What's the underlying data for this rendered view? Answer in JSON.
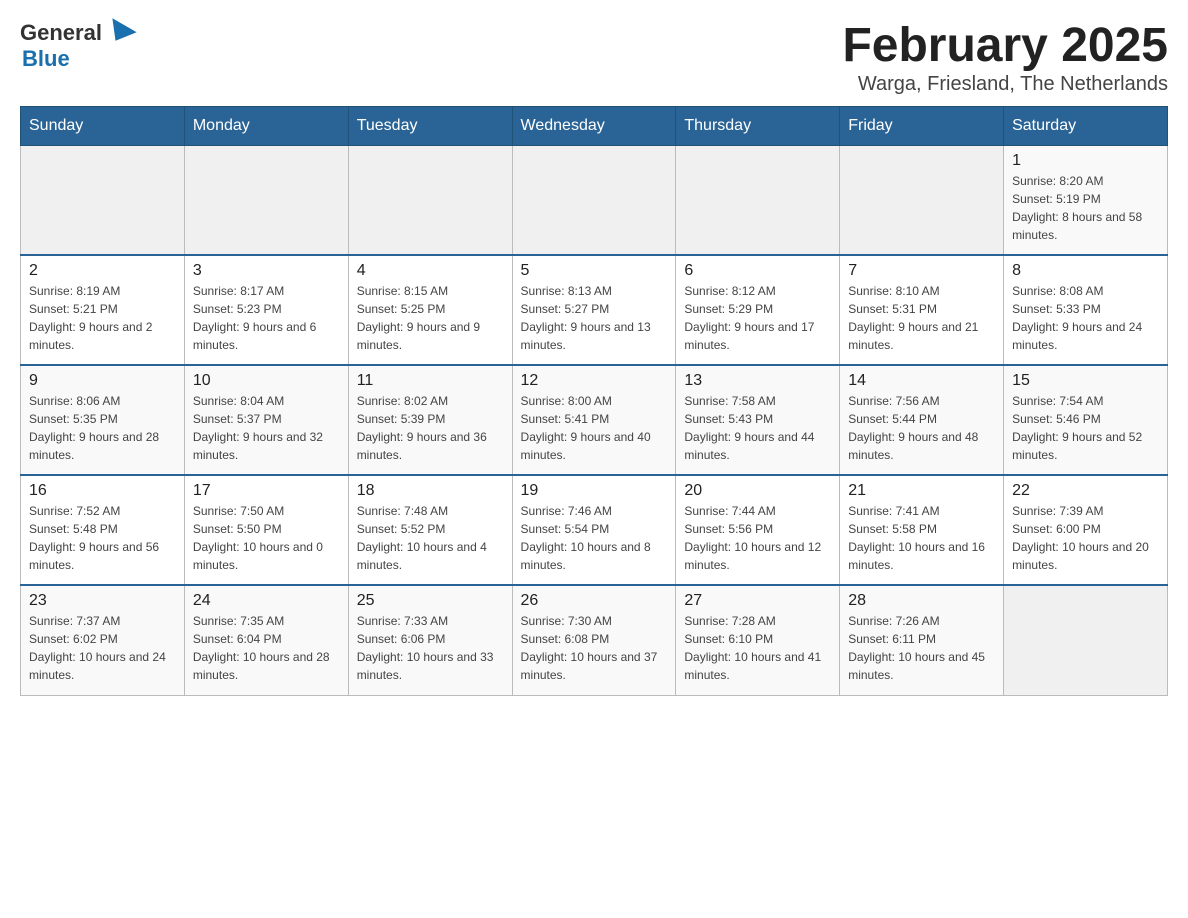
{
  "logo": {
    "general": "General",
    "blue": "Blue"
  },
  "title": "February 2025",
  "subtitle": "Warga, Friesland, The Netherlands",
  "weekdays": [
    "Sunday",
    "Monday",
    "Tuesday",
    "Wednesday",
    "Thursday",
    "Friday",
    "Saturday"
  ],
  "weeks": [
    [
      {
        "day": "",
        "info": ""
      },
      {
        "day": "",
        "info": ""
      },
      {
        "day": "",
        "info": ""
      },
      {
        "day": "",
        "info": ""
      },
      {
        "day": "",
        "info": ""
      },
      {
        "day": "",
        "info": ""
      },
      {
        "day": "1",
        "info": "Sunrise: 8:20 AM\nSunset: 5:19 PM\nDaylight: 8 hours and 58 minutes."
      }
    ],
    [
      {
        "day": "2",
        "info": "Sunrise: 8:19 AM\nSunset: 5:21 PM\nDaylight: 9 hours and 2 minutes."
      },
      {
        "day": "3",
        "info": "Sunrise: 8:17 AM\nSunset: 5:23 PM\nDaylight: 9 hours and 6 minutes."
      },
      {
        "day": "4",
        "info": "Sunrise: 8:15 AM\nSunset: 5:25 PM\nDaylight: 9 hours and 9 minutes."
      },
      {
        "day": "5",
        "info": "Sunrise: 8:13 AM\nSunset: 5:27 PM\nDaylight: 9 hours and 13 minutes."
      },
      {
        "day": "6",
        "info": "Sunrise: 8:12 AM\nSunset: 5:29 PM\nDaylight: 9 hours and 17 minutes."
      },
      {
        "day": "7",
        "info": "Sunrise: 8:10 AM\nSunset: 5:31 PM\nDaylight: 9 hours and 21 minutes."
      },
      {
        "day": "8",
        "info": "Sunrise: 8:08 AM\nSunset: 5:33 PM\nDaylight: 9 hours and 24 minutes."
      }
    ],
    [
      {
        "day": "9",
        "info": "Sunrise: 8:06 AM\nSunset: 5:35 PM\nDaylight: 9 hours and 28 minutes."
      },
      {
        "day": "10",
        "info": "Sunrise: 8:04 AM\nSunset: 5:37 PM\nDaylight: 9 hours and 32 minutes."
      },
      {
        "day": "11",
        "info": "Sunrise: 8:02 AM\nSunset: 5:39 PM\nDaylight: 9 hours and 36 minutes."
      },
      {
        "day": "12",
        "info": "Sunrise: 8:00 AM\nSunset: 5:41 PM\nDaylight: 9 hours and 40 minutes."
      },
      {
        "day": "13",
        "info": "Sunrise: 7:58 AM\nSunset: 5:43 PM\nDaylight: 9 hours and 44 minutes."
      },
      {
        "day": "14",
        "info": "Sunrise: 7:56 AM\nSunset: 5:44 PM\nDaylight: 9 hours and 48 minutes."
      },
      {
        "day": "15",
        "info": "Sunrise: 7:54 AM\nSunset: 5:46 PM\nDaylight: 9 hours and 52 minutes."
      }
    ],
    [
      {
        "day": "16",
        "info": "Sunrise: 7:52 AM\nSunset: 5:48 PM\nDaylight: 9 hours and 56 minutes."
      },
      {
        "day": "17",
        "info": "Sunrise: 7:50 AM\nSunset: 5:50 PM\nDaylight: 10 hours and 0 minutes."
      },
      {
        "day": "18",
        "info": "Sunrise: 7:48 AM\nSunset: 5:52 PM\nDaylight: 10 hours and 4 minutes."
      },
      {
        "day": "19",
        "info": "Sunrise: 7:46 AM\nSunset: 5:54 PM\nDaylight: 10 hours and 8 minutes."
      },
      {
        "day": "20",
        "info": "Sunrise: 7:44 AM\nSunset: 5:56 PM\nDaylight: 10 hours and 12 minutes."
      },
      {
        "day": "21",
        "info": "Sunrise: 7:41 AM\nSunset: 5:58 PM\nDaylight: 10 hours and 16 minutes."
      },
      {
        "day": "22",
        "info": "Sunrise: 7:39 AM\nSunset: 6:00 PM\nDaylight: 10 hours and 20 minutes."
      }
    ],
    [
      {
        "day": "23",
        "info": "Sunrise: 7:37 AM\nSunset: 6:02 PM\nDaylight: 10 hours and 24 minutes."
      },
      {
        "day": "24",
        "info": "Sunrise: 7:35 AM\nSunset: 6:04 PM\nDaylight: 10 hours and 28 minutes."
      },
      {
        "day": "25",
        "info": "Sunrise: 7:33 AM\nSunset: 6:06 PM\nDaylight: 10 hours and 33 minutes."
      },
      {
        "day": "26",
        "info": "Sunrise: 7:30 AM\nSunset: 6:08 PM\nDaylight: 10 hours and 37 minutes."
      },
      {
        "day": "27",
        "info": "Sunrise: 7:28 AM\nSunset: 6:10 PM\nDaylight: 10 hours and 41 minutes."
      },
      {
        "day": "28",
        "info": "Sunrise: 7:26 AM\nSunset: 6:11 PM\nDaylight: 10 hours and 45 minutes."
      },
      {
        "day": "",
        "info": ""
      }
    ]
  ]
}
